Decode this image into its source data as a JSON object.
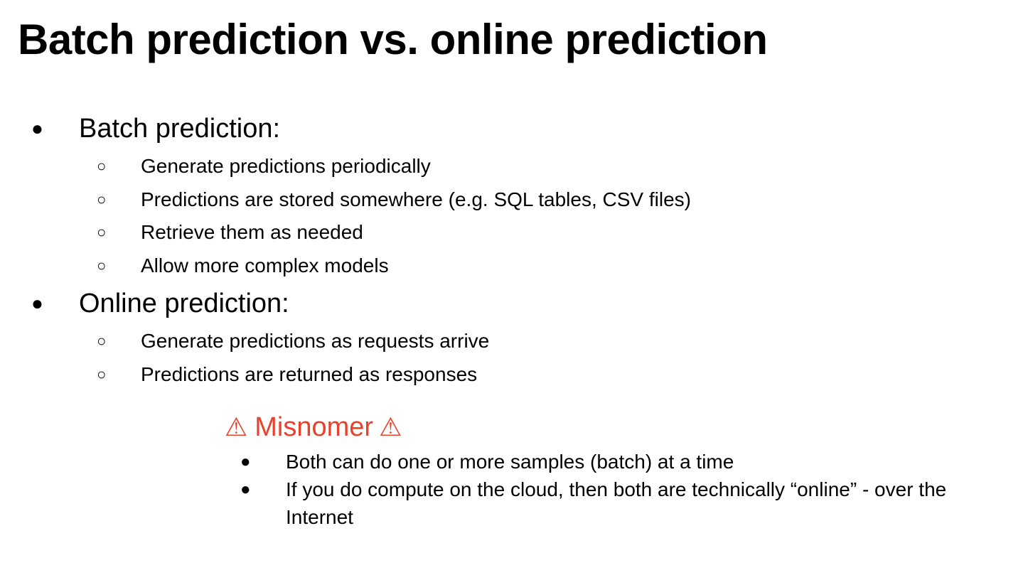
{
  "slide": {
    "title": "Batch prediction vs. online prediction",
    "sections": [
      {
        "bullet": "●",
        "label": "Batch prediction:",
        "items": [
          "Generate predictions periodically",
          "Predictions are stored somewhere (e.g. SQL tables, CSV files)",
          "Retrieve them as needed",
          "Allow more complex models"
        ]
      },
      {
        "bullet": "●",
        "label": "Online prediction:",
        "items": [
          "Generate predictions as requests arrive",
          "Predictions are returned as responses"
        ]
      }
    ],
    "sub_bullet": "○",
    "misnomer": {
      "icon": "⚠",
      "icon_name": "warning-icon",
      "heading": "Misnomer",
      "color": "#e8412c",
      "bullet": "●",
      "items": [
        "Both can do one or more samples (batch) at a time",
        "If you do compute on the cloud, then both are technically “online” - over the Internet"
      ]
    }
  }
}
